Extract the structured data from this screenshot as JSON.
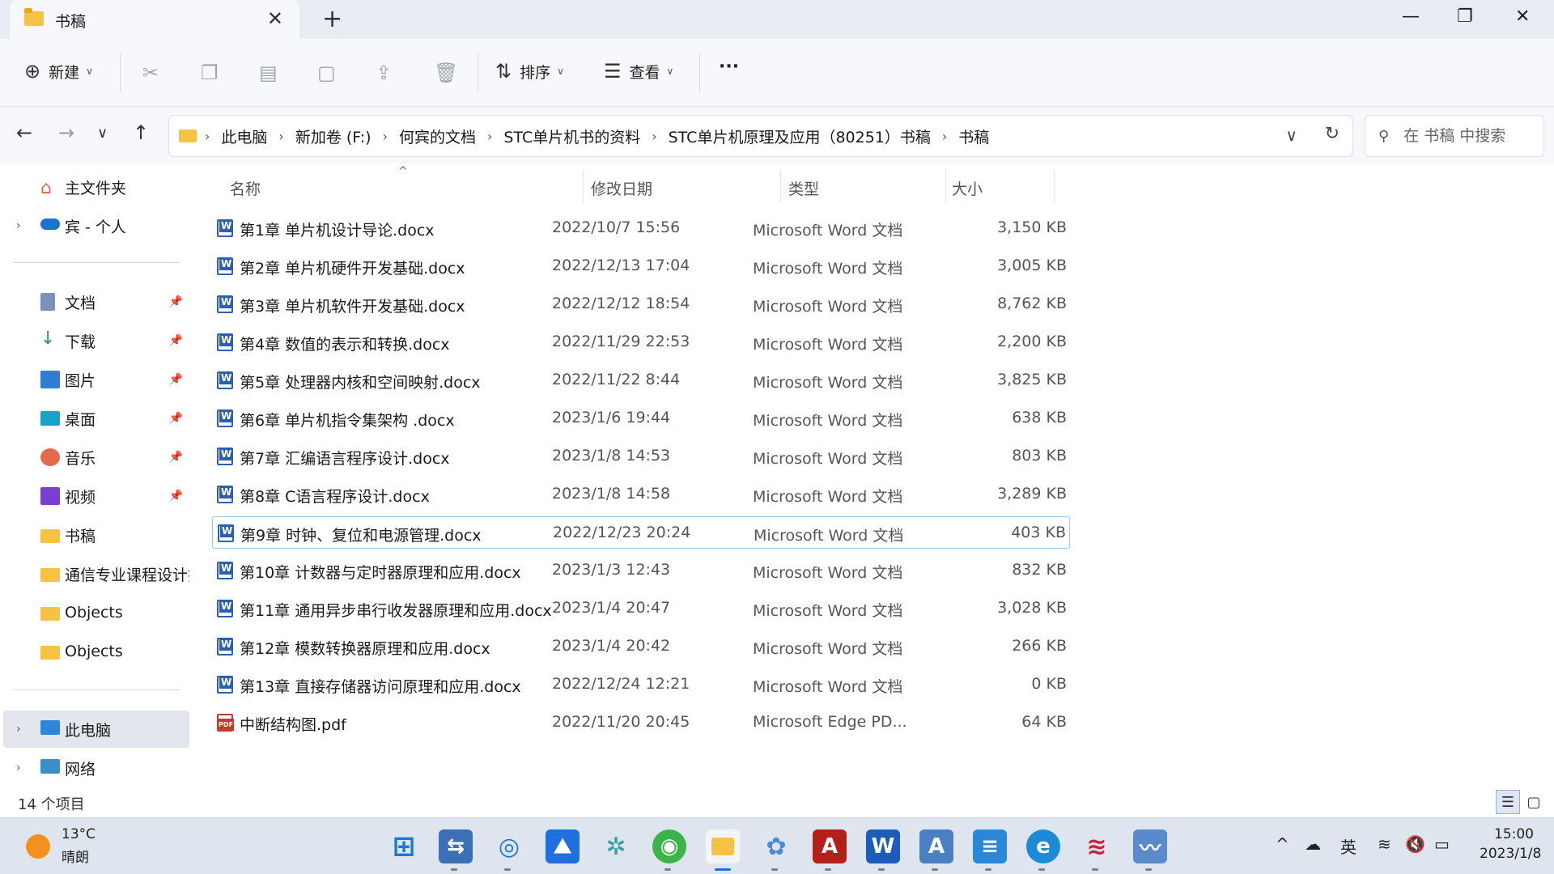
{
  "window": {
    "tab_title": "书稿",
    "new_tab": "+",
    "minimize": "—",
    "maximize": "❐",
    "close": "✕"
  },
  "toolbar": {
    "new_label": "新建",
    "sort_label": "排序",
    "view_label": "查看",
    "more_label": "···"
  },
  "breadcrumb": [
    "此电脑",
    "新加卷 (F:)",
    "何宾的文档",
    "STC单片机书的资料",
    "STC单片机原理及应用（80251）书稿",
    "书稿"
  ],
  "search": {
    "placeholder": "在 书稿 中搜索"
  },
  "sidebar": {
    "home": "主文件夹",
    "onedrive": "宾 - 个人",
    "documents": "文档",
    "downloads": "下载",
    "pictures": "图片",
    "desktop": "桌面",
    "music": "音乐",
    "videos": "视频",
    "shugao": "书稿",
    "tongxin": "通信专业课程设计指导",
    "objects1": "Objects",
    "objects2": "Objects",
    "thispc": "此电脑",
    "network": "网络"
  },
  "columns": {
    "name": "名称",
    "date": "修改日期",
    "type": "类型",
    "size": "大小"
  },
  "files": [
    {
      "name": "第1章 单片机设计导论.docx",
      "date": "2022/10/7 15:56",
      "type": "Microsoft Word 文档",
      "size": "3,150 KB"
    },
    {
      "name": "第2章 单片机硬件开发基础.docx",
      "date": "2022/12/13 17:04",
      "type": "Microsoft Word 文档",
      "size": "3,005 KB"
    },
    {
      "name": "第3章 单片机软件开发基础.docx",
      "date": "2022/12/12 18:54",
      "type": "Microsoft Word 文档",
      "size": "8,762 KB"
    },
    {
      "name": "第4章 数值的表示和转换.docx",
      "date": "2022/11/29 22:53",
      "type": "Microsoft Word 文档",
      "size": "2,200 KB"
    },
    {
      "name": "第5章 处理器内核和空间映射.docx",
      "date": "2022/11/22 8:44",
      "type": "Microsoft Word 文档",
      "size": "3,825 KB"
    },
    {
      "name": "第6章 单片机指令集架构 .docx",
      "date": "2023/1/6 19:44",
      "type": "Microsoft Word 文档",
      "size": "638 KB"
    },
    {
      "name": "第7章 汇编语言程序设计.docx",
      "date": "2023/1/8 14:53",
      "type": "Microsoft Word 文档",
      "size": "803 KB"
    },
    {
      "name": "第8章 C语言程序设计.docx",
      "date": "2023/1/8 14:58",
      "type": "Microsoft Word 文档",
      "size": "3,289 KB"
    },
    {
      "name": "第9章 时钟、复位和电源管理.docx",
      "date": "2022/12/23 20:24",
      "type": "Microsoft Word 文档",
      "size": "403 KB"
    },
    {
      "name": "第10章 计数器与定时器原理和应用.docx",
      "date": "2023/1/3 12:43",
      "type": "Microsoft Word 文档",
      "size": "832 KB"
    },
    {
      "name": "第11章 通用异步串行收发器原理和应用.docx",
      "date": "2023/1/4 20:47",
      "type": "Microsoft Word 文档",
      "size": "3,028 KB"
    },
    {
      "name": "第12章 模数转换器原理和应用.docx",
      "date": "2023/1/4 20:42",
      "type": "Microsoft Word 文档",
      "size": "266 KB"
    },
    {
      "name": "第13章 直接存储器访问原理和应用.docx",
      "date": "2022/12/24 12:21",
      "type": "Microsoft Word 文档",
      "size": "0 KB"
    },
    {
      "name": "中断结构图.pdf",
      "date": "2022/11/20 20:45",
      "type": "Microsoft Edge PD...",
      "size": "64 KB"
    }
  ],
  "status": {
    "count": "14 个项目"
  },
  "taskbar": {
    "weather_temp": "13°C",
    "weather_desc": "晴朗",
    "ime": "英",
    "time": "15:00",
    "date": "2023/1/8"
  }
}
